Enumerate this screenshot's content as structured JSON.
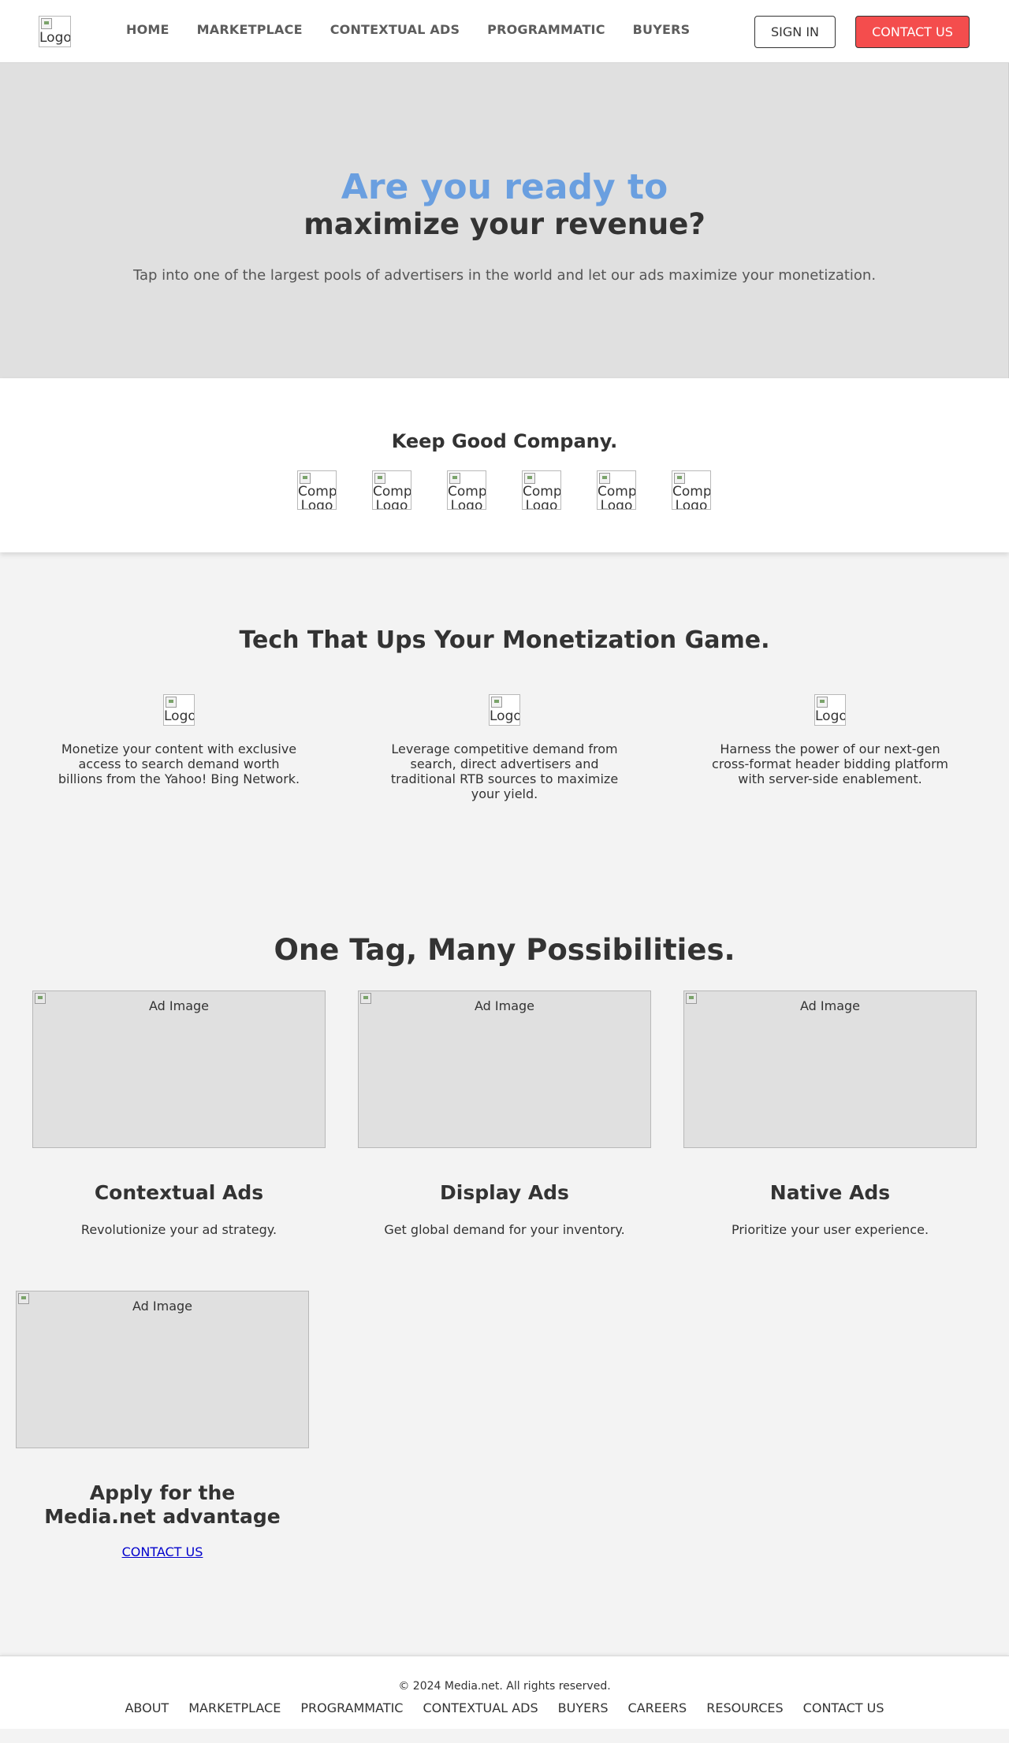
{
  "header": {
    "logo_alt": "Logo",
    "nav": [
      "HOME",
      "MARKETPLACE",
      "CONTEXTUAL ADS",
      "PROGRAMMATIC",
      "BUYERS"
    ],
    "sign_in_label": "SIGN IN",
    "contact_label": "CONTACT US"
  },
  "hero": {
    "line1": "Are you ready to",
    "line2": "maximize your revenue?",
    "subtitle": "Tap into one of the largest pools of advertisers in the world and let our ads maximize your monetization."
  },
  "company": {
    "title": "Keep Good Company.",
    "logo_alt": "Company Logo",
    "logo_count": 6
  },
  "tech": {
    "title": "Tech That Ups Your Monetization Game.",
    "features": [
      {
        "logo_alt": "Logo",
        "text": "Monetize your content with exclusive access to search demand worth billions from the Yahoo! Bing Network."
      },
      {
        "logo_alt": "Logo",
        "text": "Leverage competitive demand from search, direct advertisers and traditional RTB sources to maximize your yield."
      },
      {
        "logo_alt": "Logo",
        "text": "Harness the power of our next-gen cross-format header bidding platform with server-side enablement."
      }
    ]
  },
  "possibilities": {
    "title": "One Tag, Many Possibilities.",
    "cards": [
      {
        "image_alt": "Ad Image",
        "title": "Contextual Ads",
        "desc": "Revolutionize your ad strategy."
      },
      {
        "image_alt": "Ad Image",
        "title": "Display Ads",
        "desc": "Get global demand for your inventory."
      },
      {
        "image_alt": "Ad Image",
        "title": "Native Ads",
        "desc": "Prioritize your user experience."
      },
      {
        "image_alt": "Ad Image",
        "title": "Apply for the Media.net advantage",
        "link": "CONTACT US"
      }
    ]
  },
  "footer": {
    "copyright": "© 2024 Media.net. All rights reserved.",
    "links": [
      "ABOUT",
      "MARKETPLACE",
      "PROGRAMMATIC",
      "CONTEXTUAL ADS",
      "BUYERS",
      "CAREERS",
      "RESOURCES",
      "CONTACT US"
    ]
  },
  "colors": {
    "accent_blue": "#6a9fe0",
    "contact_red": "#f44d4d",
    "hero_bg": "#e0e0e0",
    "section_bg": "#f3f3f3",
    "text_dark": "#333333",
    "link_blue": "#0000cc"
  },
  "icons": [
    "broken-image-icon"
  ]
}
